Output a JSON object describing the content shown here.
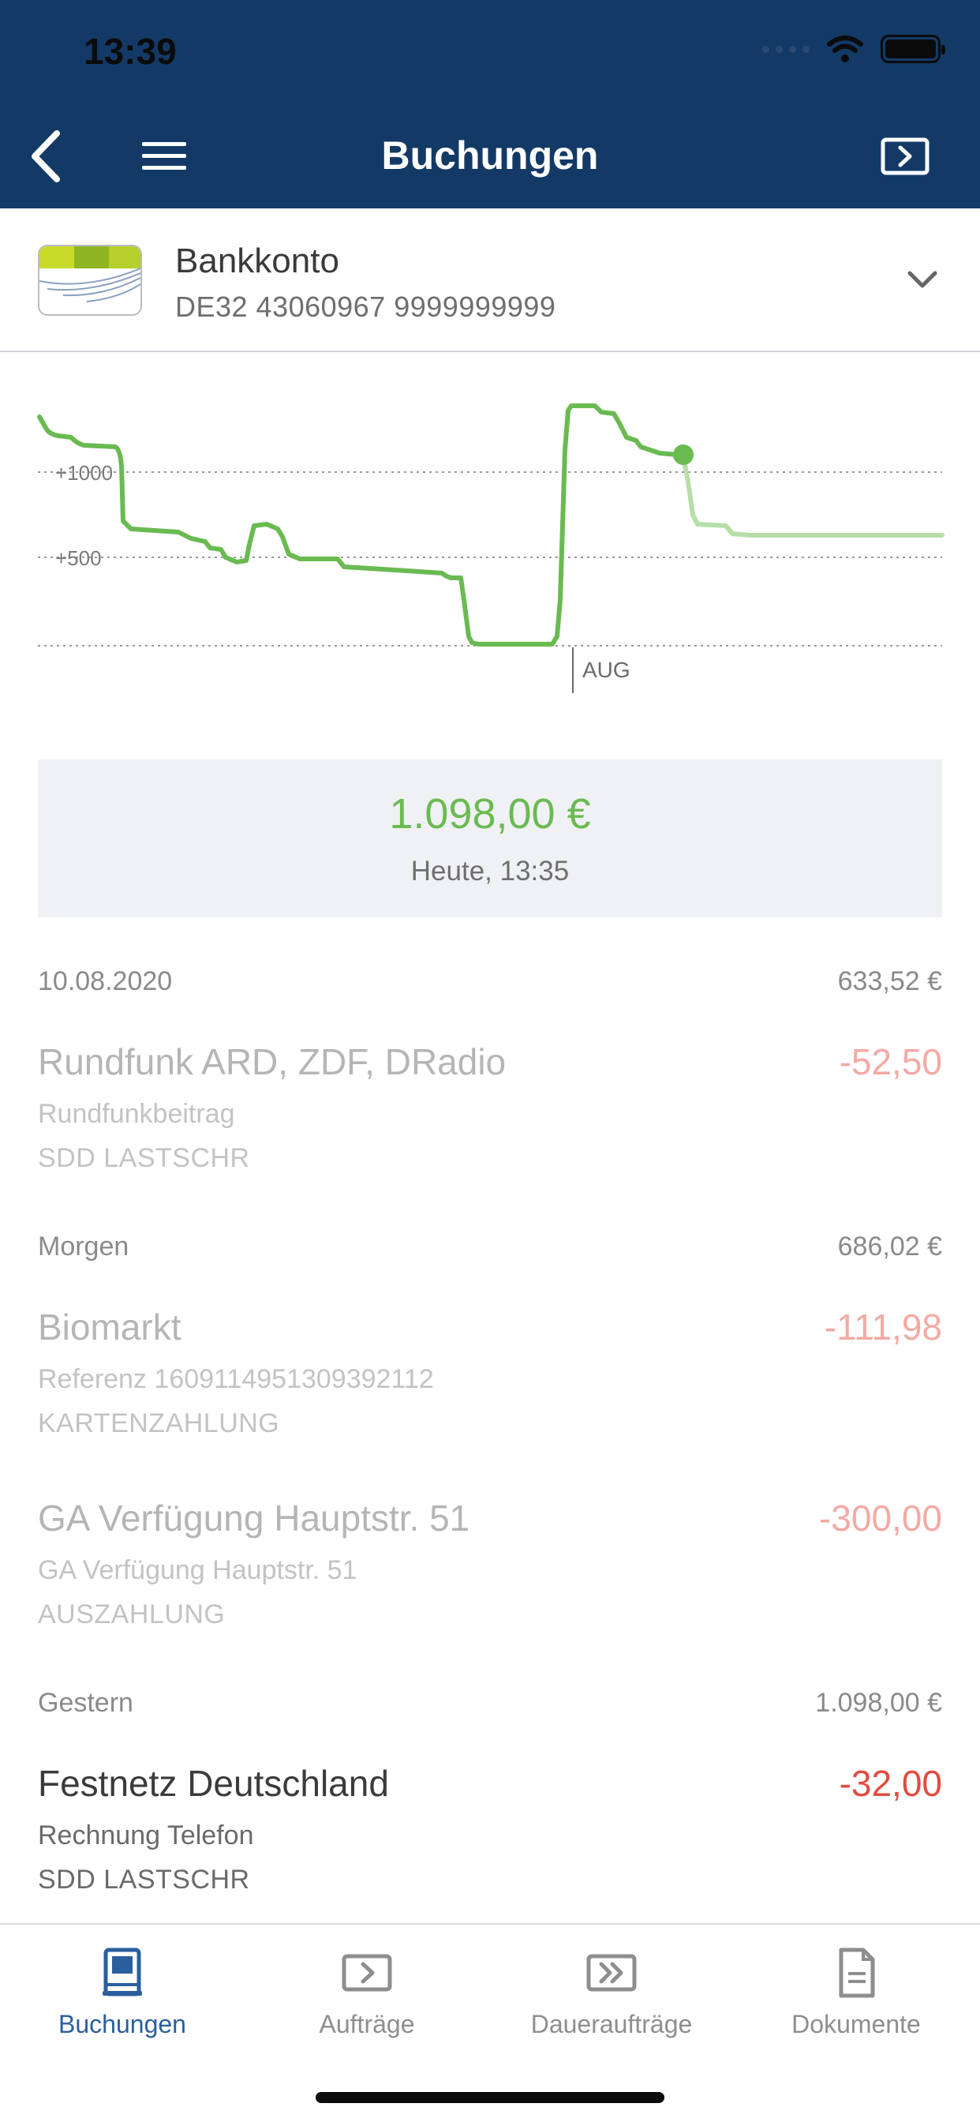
{
  "status_bar": {
    "time": "13:39"
  },
  "nav": {
    "title": "Buchungen"
  },
  "account": {
    "name": "Bankkonto",
    "iban": "DE32 43060967 9999999999"
  },
  "chart_data": {
    "type": "line",
    "y_tick_labels": [
      "+1000",
      "+500"
    ],
    "x_marker_label": "AUG",
    "colors": {
      "line": "#6aba52",
      "forecast": "#b6dfa8",
      "grid": "#9a9a9a"
    }
  },
  "balance": {
    "amount": "1.098,00 €",
    "time": "Heute, 13:35"
  },
  "days": [
    {
      "label": "10.08.2020",
      "sum": "633,52 €",
      "transactions": [
        {
          "title": "Rundfunk ARD, ZDF, DRadio",
          "amount": "-52,50",
          "sub1": "Rundfunkbeitrag",
          "sub2": "SDD LASTSCHR",
          "state": "pending"
        }
      ]
    },
    {
      "label": "Morgen",
      "sum": "686,02 €",
      "transactions": [
        {
          "title": "Biomarkt",
          "amount": "-111,98",
          "sub1": "Referenz 1609114951309392112",
          "sub2": "KARTENZAHLUNG",
          "state": "pending"
        },
        {
          "title": "GA Verfügung Hauptstr. 51",
          "amount": "-300,00",
          "sub1": "GA Verfügung Hauptstr. 51",
          "sub2": "AUSZAHLUNG",
          "state": "pending"
        }
      ]
    },
    {
      "label": "Gestern",
      "sum": "1.098,00 €",
      "transactions": [
        {
          "title": "Festnetz Deutschland",
          "amount": "-32,00",
          "sub1": "Rechnung Telefon",
          "sub2": "SDD LASTSCHR",
          "state": "booked"
        }
      ]
    }
  ],
  "tabs": [
    {
      "label": "Buchungen",
      "icon": "book-icon",
      "active": true
    },
    {
      "label": "Aufträge",
      "icon": "transfer-icon",
      "active": false
    },
    {
      "label": "Daueraufträge",
      "icon": "standing-order-icon",
      "active": false
    },
    {
      "label": "Dokumente",
      "icon": "document-icon",
      "active": false
    }
  ],
  "theme": {
    "header_bg": "#133a66",
    "accent": "#2a5f9e",
    "positive": "#6aba52",
    "negative": "#e34b3f"
  }
}
